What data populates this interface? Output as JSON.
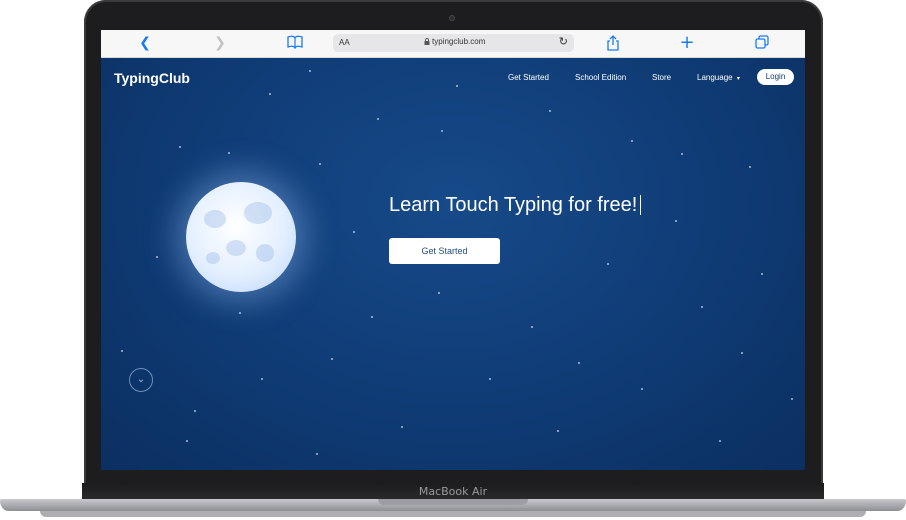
{
  "device": {
    "model_label": "MacBook Air"
  },
  "browser": {
    "back_icon": "chevron-left-icon",
    "forward_icon": "chevron-right-icon",
    "bookmarks_icon": "book-icon",
    "text_size_label": "AA",
    "url": "typingclub.com",
    "share_icon": "share-icon",
    "new_tab_icon": "plus-icon",
    "tabs_icon": "tabs-icon"
  },
  "site": {
    "logo": "TypingClub",
    "nav": {
      "get_started": "Get Started",
      "school_edition": "School Edition",
      "store": "Store",
      "language": "Language",
      "login": "Login"
    },
    "hero": {
      "headline": "Learn Touch Typing for free!",
      "cta_label": "Get Started"
    },
    "colors": {
      "background": "#0f3b75",
      "accent": "#1a7cf2"
    }
  }
}
